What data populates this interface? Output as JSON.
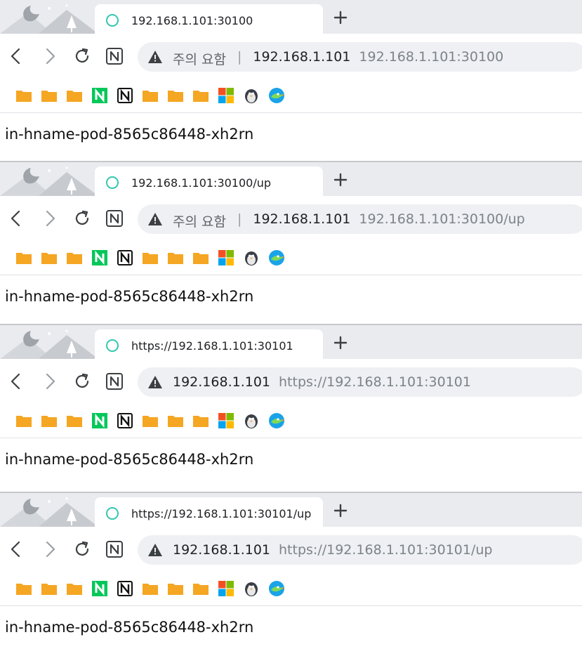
{
  "windows": [
    {
      "tab_title": "192.168.1.101:30100",
      "warning_text": "주의 요함",
      "separator": "|",
      "address_host": "192.168.1.101",
      "address_url": "192.168.1.101:30100",
      "page_text": "in-hname-pod-8565c86448-xh2rn"
    },
    {
      "tab_title": "192.168.1.101:30100/up",
      "warning_text": "주의 요함",
      "separator": "|",
      "address_host": "192.168.1.101",
      "address_url": "192.168.1.101:30100/up",
      "page_text": "in-hname-pod-8565c86448-xh2rn"
    },
    {
      "tab_title": "https://192.168.1.101:30101",
      "warning_text": "",
      "separator": "",
      "address_host": "192.168.1.101",
      "address_url": "https://192.168.1.101:30101",
      "page_text": "in-hname-pod-8565c86448-xh2rn"
    },
    {
      "tab_title": "https://192.168.1.101:30101/up",
      "warning_text": "",
      "separator": "",
      "address_host": "192.168.1.101",
      "address_url": "https://192.168.1.101:30101/up",
      "page_text": "in-hname-pod-8565c86448-xh2rn"
    }
  ],
  "bookmark_icons": [
    "folder-icon",
    "folder-icon",
    "folder-icon",
    "naver-icon",
    "notion-icon",
    "folder-icon",
    "folder-icon",
    "folder-icon",
    "microsoft-icon",
    "penguin-icon",
    "bird-icon"
  ],
  "colors": {
    "tab_icon": "#34c7b0",
    "folder": "#f5a623",
    "naver": "#03c75a"
  }
}
